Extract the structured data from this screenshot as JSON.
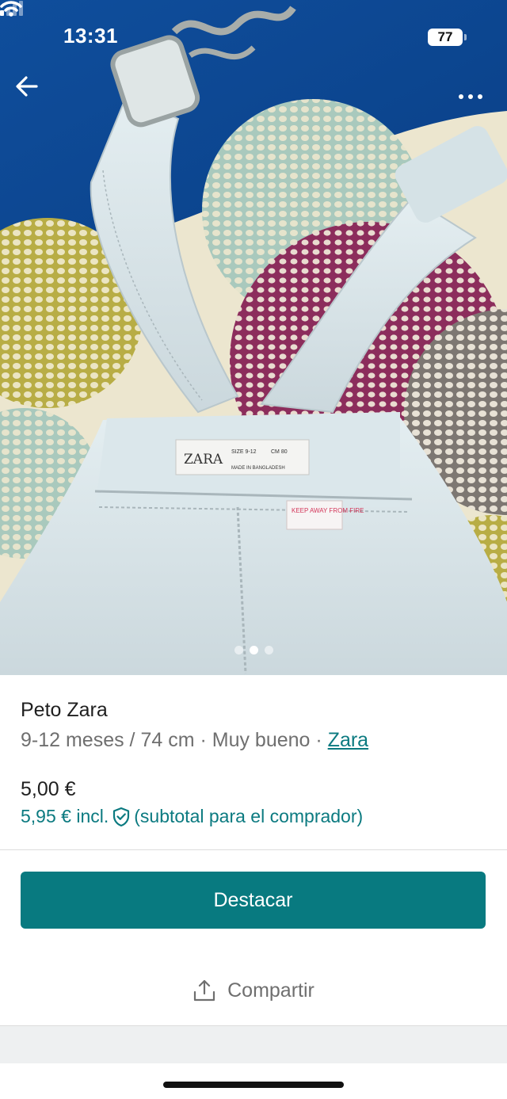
{
  "status_bar": {
    "time": "13:31",
    "battery": "77",
    "icons": [
      "signal-icon",
      "wifi-icon",
      "battery-icon"
    ]
  },
  "header": {
    "back_icon": "arrow-left-icon",
    "more_icon": "more-horizontal-icon"
  },
  "photo": {
    "label_brand": "ZARA",
    "label_size": "SIZE 9-12",
    "label_cm": "CM 80",
    "label_origin": "MADE IN BANGLADESH",
    "care_label": "KEEP AWAY FROM FIRE",
    "pager": {
      "count": 3,
      "active_index": 1
    }
  },
  "item": {
    "title": "Peto Zara",
    "size": "9-12 meses / 74 cm",
    "separator": " · ",
    "condition": "Muy bueno",
    "brand": "Zara",
    "price": "5,00 €",
    "buyer_price": "5,95 € incl.",
    "buyer_price_icon": "shield-check-icon",
    "buyer_price_note": "(subtotal para el comprador)"
  },
  "actions": {
    "promote_label": "Destacar",
    "share_label": "Compartir",
    "share_icon": "share-icon"
  },
  "colors": {
    "accent": "#087a80",
    "link": "#0b7a80",
    "text": "#1f1f1f",
    "muted": "#6f6f6f"
  }
}
